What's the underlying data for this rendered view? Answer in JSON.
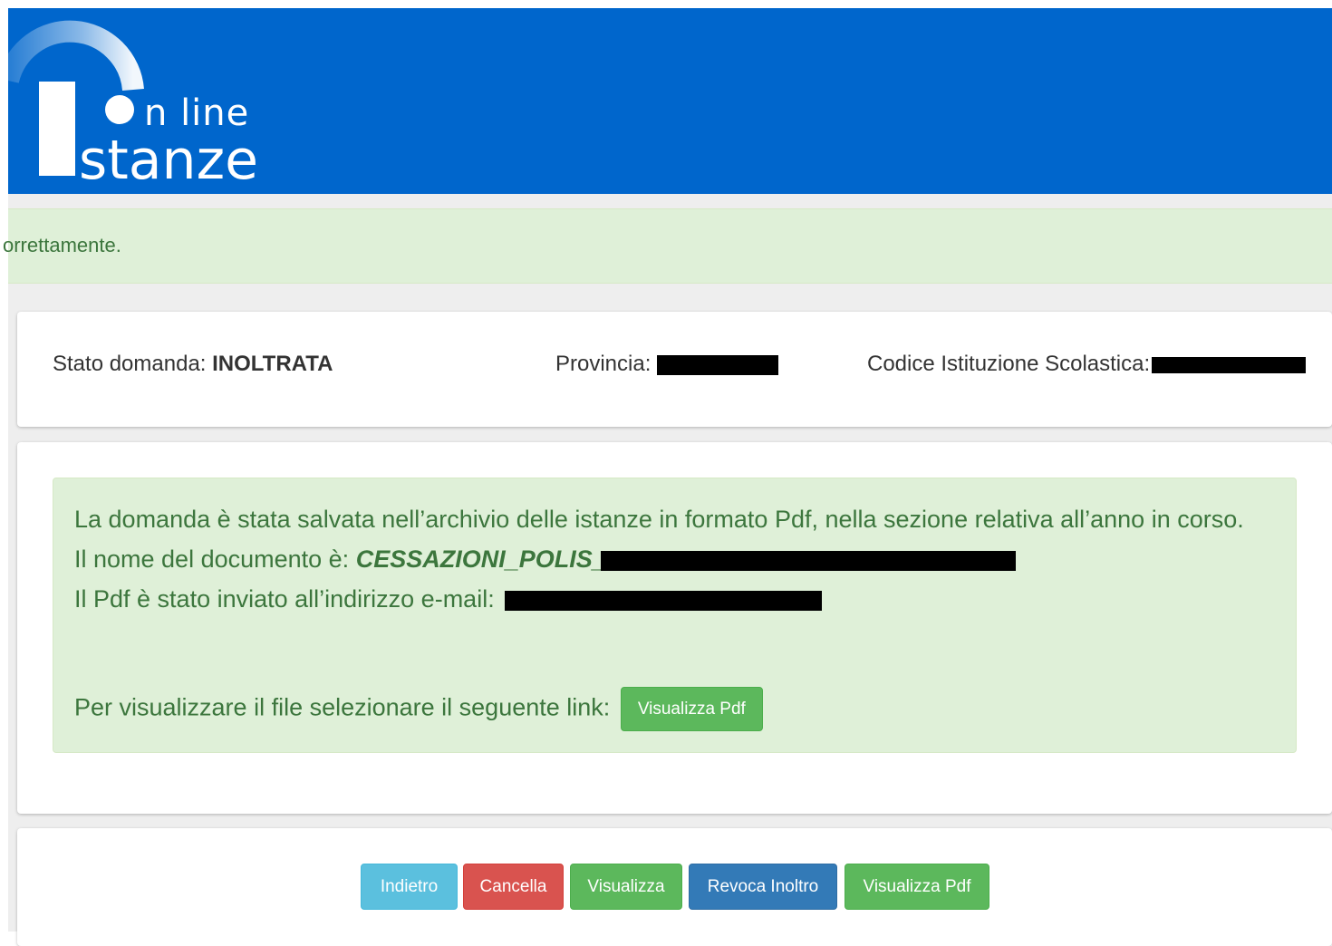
{
  "header": {
    "logo_line1": "n line",
    "logo_line2": "stanze"
  },
  "alert_top": {
    "text": "orrettamente."
  },
  "status": {
    "stato_label": "Stato domanda:",
    "stato_value": "INOLTRATA",
    "provincia_label": "Provincia:",
    "codice_label": "Codice Istituzione Scolastica:"
  },
  "message": {
    "line1": "La domanda è stata salvata nell’archivio delle istanze in formato Pdf, nella sezione relativa all’anno in corso.",
    "doc_label": "Il nome del documento è:",
    "doc_name_visible": "CESSAZIONI_POLIS_",
    "email_label": "Il Pdf è stato inviato all’indirizzo e-mail:",
    "link_label": "Per visualizzare il file selezionare il seguente link:",
    "link_button": "Visualizza Pdf"
  },
  "actions": {
    "indietro": "Indietro",
    "cancella": "Cancella",
    "visualizza": "Visualizza",
    "revoca": "Revoca Inoltro",
    "visualizza_pdf": "Visualizza Pdf"
  },
  "colors": {
    "header_bg": "#0066cc",
    "alert_bg": "#dff0d8",
    "alert_text": "#3c763d",
    "success": "#5cb85c",
    "info": "#5bc0de",
    "danger": "#d9534f",
    "primary": "#337ab7"
  }
}
